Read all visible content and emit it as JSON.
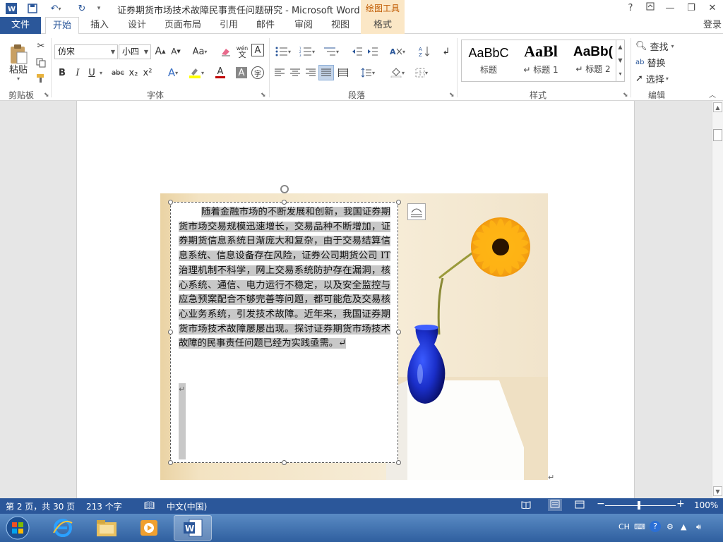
{
  "titlebar": {
    "title": "证券期货市场技术故障民事责任问题研究 - Microsoft Word",
    "contextual": "绘图工具",
    "help": "?",
    "minimize": "—",
    "restore": "❐",
    "close": "✕"
  },
  "tabs": {
    "file": "文件",
    "items": [
      "开始",
      "插入",
      "设计",
      "页面布局",
      "引用",
      "邮件",
      "审阅",
      "视图"
    ],
    "context": "格式",
    "login": "登录"
  },
  "ribbon": {
    "clipboard": {
      "paste": "粘贴",
      "label": "剪贴板"
    },
    "font": {
      "name": "仿宋",
      "size": "小四",
      "label": "字体",
      "grow": "A",
      "shrink": "A",
      "case": "Aa",
      "pinyin": "wén",
      "border_char": "A",
      "bold": "B",
      "italic": "I",
      "underline": "U",
      "strike": "abc",
      "sub": "x₂",
      "sup": "x²",
      "font_color": "A",
      "shade_char": "A",
      "enclose_char": "字"
    },
    "paragraph": {
      "label": "段落"
    },
    "styles": {
      "label": "样式",
      "items": [
        {
          "sample": "AaBbC",
          "name": "标题"
        },
        {
          "sample": "AaBl",
          "name": "↵ 标题 1"
        },
        {
          "sample": "AaBb(",
          "name": "↵ 标题 2"
        }
      ]
    },
    "editing": {
      "label": "编辑",
      "find": "查找",
      "replace": "替换",
      "select": "选择"
    }
  },
  "document": {
    "textbox_text": "随着金融市场的不断发展和创新，我国证券期货市场交易规模迅速增长，交易品种不断增加，证券期货信息系统日渐庞大和复杂，由于交易结算信息系统、信息设备存在风险，证券公司期货公司 IT 治理机制不科学，网上交易系统防护存在漏洞，核心系统、通信、电力运行不稳定，以及安全监控与应急预案配合不够完善等问题，都可能危及交易核心业务系统，引发技术故障。近年来，我国证券期货市场技术故障屡屡出现。探讨证券期货市场技术故障的民事责任问题已经为实践亟需。↵",
    "para_mark": "↵"
  },
  "statusbar": {
    "page": "第 2 页，共 30 页",
    "words": "213 个字",
    "lang": "中文(中国)",
    "zoom": "100%"
  },
  "taskbar": {
    "tray_lang": "CH"
  },
  "colors": {
    "accent": "#2b579a",
    "contextual_bg": "#fbe7c6",
    "contextual_text": "#c05a00"
  }
}
